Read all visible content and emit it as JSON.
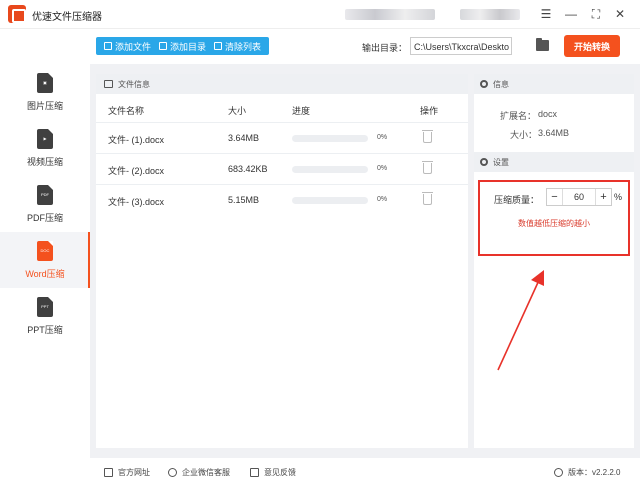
{
  "app": {
    "title": "优速文件压缩器"
  },
  "window_controls": {
    "menu": "☰",
    "minimize": "—",
    "maximize": "⛶",
    "close": "✕"
  },
  "toolbar": {
    "add_file": "添加文件",
    "add_folder": "添加目录",
    "clear_list": "清除列表",
    "output_label": "输出目录：",
    "output_path": "C:\\Users\\Tkxcra\\Deskto",
    "start": "开始转换"
  },
  "sidebar": {
    "items": [
      {
        "label": "图片压缩",
        "icon": "image-doc-icon",
        "glyph": "▣"
      },
      {
        "label": "视频压缩",
        "icon": "video-doc-icon",
        "glyph": "▶"
      },
      {
        "label": "PDF压缩",
        "icon": "pdf-doc-icon",
        "glyph": "PDF"
      },
      {
        "label": "Word压缩",
        "icon": "word-doc-icon",
        "glyph": "DOC",
        "active": true
      },
      {
        "label": "PPT压缩",
        "icon": "ppt-doc-icon",
        "glyph": "PPT"
      }
    ]
  },
  "files": {
    "header": "文件信息",
    "columns": {
      "name": "文件名称",
      "size": "大小",
      "progress": "进度",
      "action": "操作"
    },
    "rows": [
      {
        "name": "文件- (1).docx",
        "size": "3.64MB",
        "progress": 0,
        "progress_label": "0%"
      },
      {
        "name": "文件- (2).docx",
        "size": "683.42KB",
        "progress": 0,
        "progress_label": "0%"
      },
      {
        "name": "文件- (3).docx",
        "size": "5.15MB",
        "progress": 0,
        "progress_label": "0%"
      }
    ]
  },
  "info": {
    "header": "信息",
    "ext_label": "扩展名：",
    "ext_value": "docx",
    "size_label": "大小：",
    "size_value": "3.64MB"
  },
  "settings": {
    "header": "设置",
    "quality_label": "压缩质量：",
    "minus": "−",
    "value": "60",
    "plus": "+",
    "unit": "%",
    "hint": "数值越低压缩的越小"
  },
  "footer": {
    "website": "官方网址",
    "wechat": "企业微信客服",
    "feedback": "意见反馈",
    "version": "版本：v2.2.2.0"
  },
  "colors": {
    "accent": "#f4511e",
    "blue": "#2aa7e8",
    "annotation": "#e8322a"
  }
}
